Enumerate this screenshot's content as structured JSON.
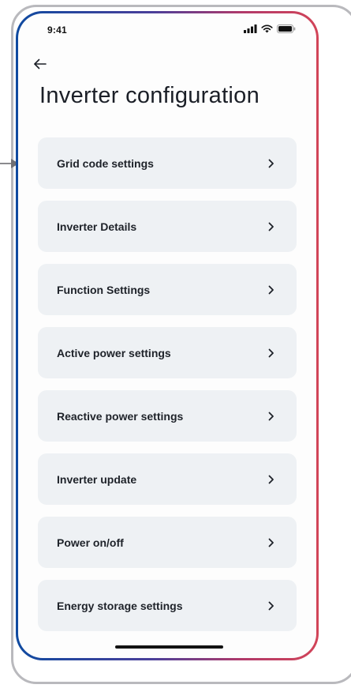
{
  "status_bar": {
    "time": "9:41"
  },
  "header": {
    "back_icon": "arrow-left-icon",
    "title": "Inverter configuration"
  },
  "menu": {
    "items": [
      {
        "label": "Grid code settings"
      },
      {
        "label": "Inverter Details"
      },
      {
        "label": "Function Settings"
      },
      {
        "label": "Active power settings"
      },
      {
        "label": "Reactive power settings"
      },
      {
        "label": "Inverter update"
      },
      {
        "label": "Power on/off"
      },
      {
        "label": "Energy storage settings"
      }
    ],
    "chevron_icon": "chevron-right-icon"
  },
  "colors": {
    "frame_gradient_start": "#0f4aa0",
    "frame_gradient_end": "#d24458",
    "item_background": "#eef1f4",
    "outer_frame": "#b9b9bd"
  }
}
